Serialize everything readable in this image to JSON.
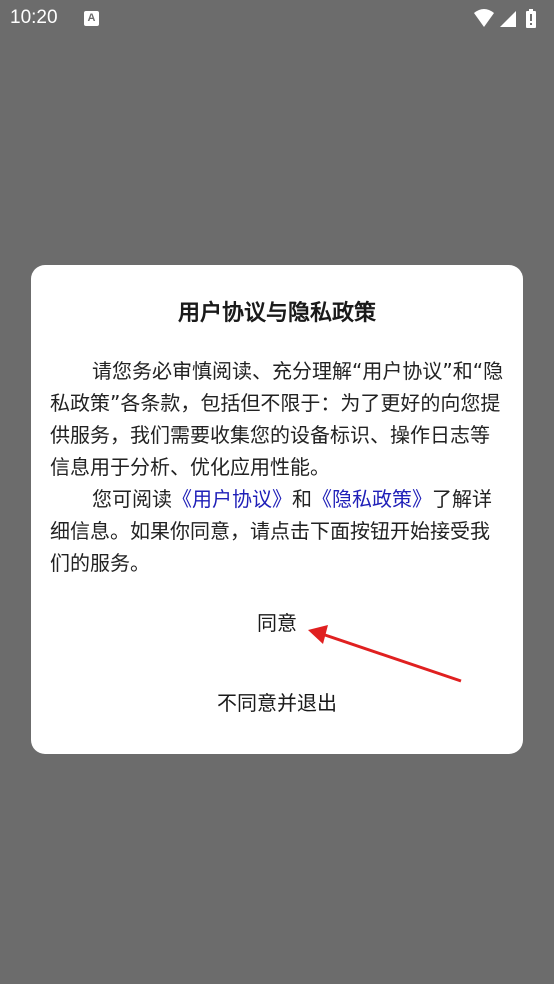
{
  "status_bar": {
    "time": "10:20",
    "notification_icon": "A"
  },
  "dialog": {
    "title": "用户协议与隐私政策",
    "paragraph1": "请您务必审慎阅读、充分理解“用户协议”和“隐私政策”各条款，包括但不限于：为了更好的向您提供服务，我们需要收集您的设备标识、操作日志等信息用于分析、优化应用性能。",
    "paragraph2_prefix": "您可阅读",
    "user_agreement_link": "《用户协议》",
    "paragraph2_and": "和",
    "privacy_policy_link": "《隐私政策》",
    "paragraph2_suffix": "了解详细信息。如果你同意，请点击下面按钮开始接受我们的服务。",
    "agree_label": "同意",
    "disagree_label": "不同意并退出"
  },
  "colors": {
    "overlay": "#6c6c6c",
    "link": "#1f1fb8",
    "annotation_arrow": "#e02020"
  },
  "icons": [
    "wifi-icon",
    "signal-icon",
    "battery-icon",
    "notification-icon"
  ]
}
